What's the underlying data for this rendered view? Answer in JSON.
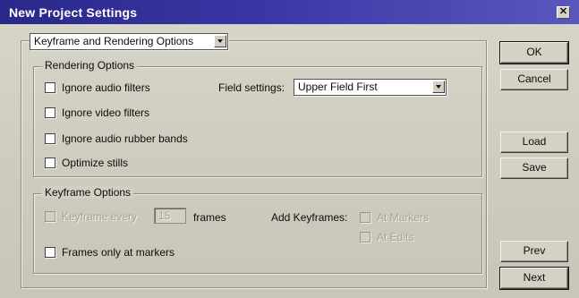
{
  "window": {
    "title": "New Project Settings",
    "close_label": "✕"
  },
  "section_select": {
    "selected": "Keyframe and Rendering Options"
  },
  "rendering_options": {
    "title": "Rendering Options",
    "ignore_audio_filters": "Ignore audio filters",
    "ignore_video_filters": "Ignore video filters",
    "ignore_audio_rubber_bands": "Ignore audio rubber bands",
    "optimize_stills": "Optimize stills",
    "field_settings_label": "Field settings:",
    "field_settings_value": "Upper Field First"
  },
  "keyframe_options": {
    "title": "Keyframe Options",
    "keyframe_every_label": "Keyframe every",
    "keyframe_every_value": "15",
    "frames_label": "frames",
    "add_keyframes_label": "Add Keyframes:",
    "at_markers": "At Markers",
    "at_edits": "At Edits",
    "frames_only_at_markers": "Frames only at markers"
  },
  "buttons": {
    "ok": "OK",
    "cancel": "Cancel",
    "load": "Load",
    "save": "Save",
    "prev": "Prev",
    "next": "Next"
  }
}
